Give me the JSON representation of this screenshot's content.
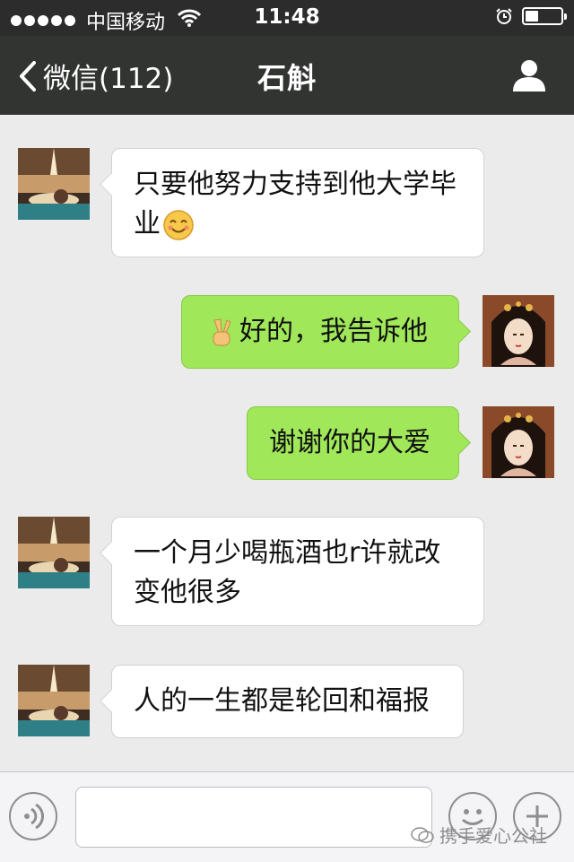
{
  "status_bar": {
    "carrier": "中国移动",
    "time": "11:48"
  },
  "nav": {
    "back_label": "微信(112)",
    "title": "石斛"
  },
  "messages": [
    {
      "side": "in",
      "text": "只要他努力支持到他大学毕业",
      "emoji": "smiling-face-emoji"
    },
    {
      "side": "out",
      "text": "好的，我告诉他",
      "emoji": "victory-hand-emoji"
    },
    {
      "side": "out",
      "text": "谢谢你的大爱"
    },
    {
      "side": "in",
      "text": "一个月少喝瓶酒也r许就改变他很多"
    },
    {
      "side": "in",
      "text": "人的一生都是轮回和福报"
    }
  ],
  "input": {
    "value": "",
    "placeholder": ""
  },
  "watermark": "携手爱心公社",
  "colors": {
    "statusbar": "#2b2c2b",
    "navbar": "#323432",
    "bubble_out": "#a0e759",
    "bubble_in": "#ffffff",
    "background": "#ebebeb"
  }
}
